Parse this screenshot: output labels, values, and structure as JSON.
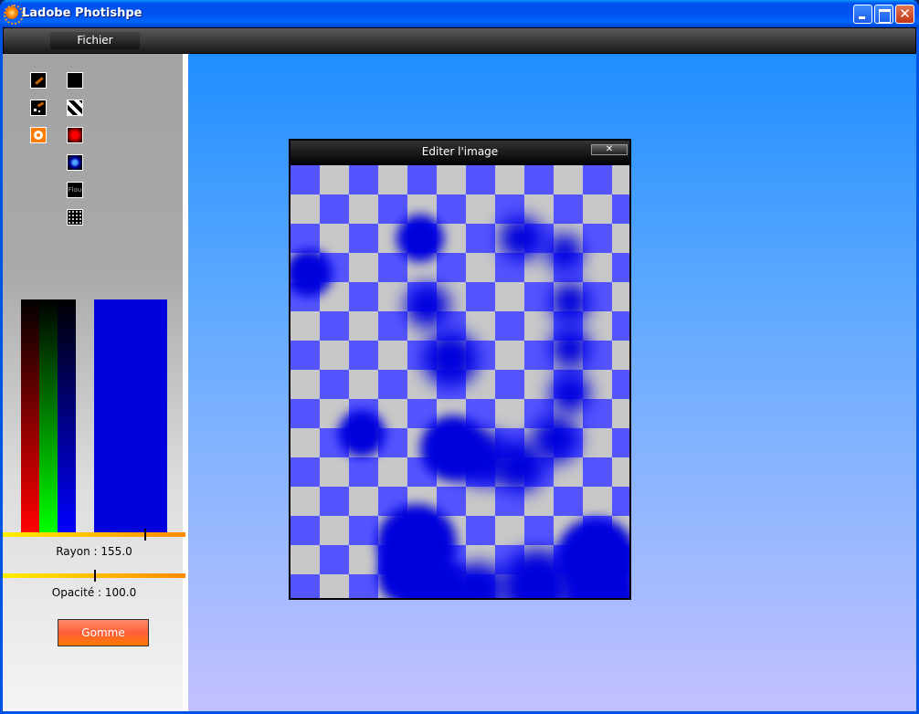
{
  "window": {
    "title": "Ladobe Photishpe"
  },
  "menu": {
    "file_label": "Fichier"
  },
  "tools": [
    {
      "name": "brush-tool",
      "icon": "brush-icon",
      "col": 0,
      "row": 0
    },
    {
      "name": "grid-tool",
      "icon": "grid-icon",
      "col": 1,
      "row": 0
    },
    {
      "name": "spray-tool",
      "icon": "spray-icon",
      "col": 0,
      "row": 1
    },
    {
      "name": "stripes-tool",
      "icon": "diagonal-stripes-icon",
      "col": 1,
      "row": 1
    },
    {
      "name": "ring-tool",
      "icon": "ring-icon",
      "col": 0,
      "row": 2
    },
    {
      "name": "red-fill-tool",
      "icon": "red-dot-icon",
      "col": 1,
      "row": 2
    },
    {
      "name": "blue-fill-tool",
      "icon": "blue-dot-icon",
      "col": 1,
      "row": 3
    },
    {
      "name": "blur-tool",
      "icon": "blur-icon",
      "col": 1,
      "row": 4,
      "text": "Flou"
    },
    {
      "name": "noise-tool",
      "icon": "noise-icon",
      "col": 1,
      "row": 5
    }
  ],
  "color": {
    "current": "#0000dd",
    "r": 0,
    "g": 0,
    "b": 221
  },
  "radius": {
    "label": "Rayon : 155.0",
    "fraction": 0.775
  },
  "opacity": {
    "label": "Opacité : 100.0",
    "fraction": 0.5
  },
  "eraser_button": "Gomme",
  "editor": {
    "title": "Editer l'image",
    "close_label": "✕"
  },
  "canvas_colors": {
    "checker_a": "#5555ff",
    "checker_b": "#c8c8c8",
    "paint": "#0000dd"
  }
}
